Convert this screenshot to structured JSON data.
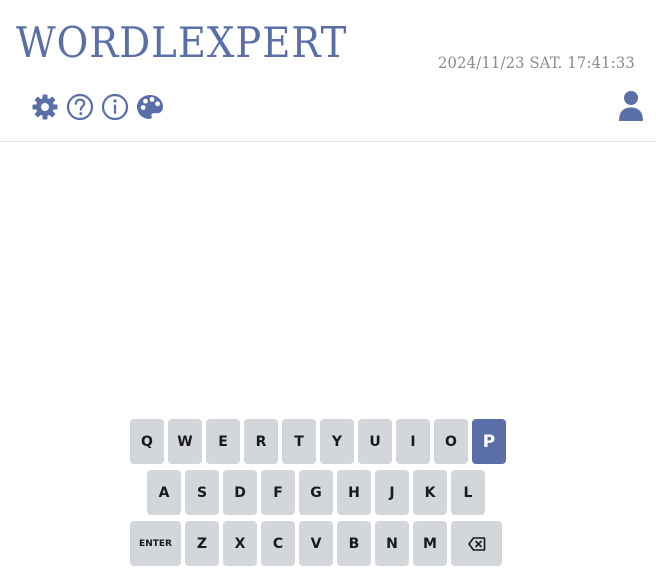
{
  "header": {
    "logo": "WORDLEXPERT",
    "datetime": "2024/11/23 SAT. 17:41:33"
  },
  "toolbar": {
    "icons": [
      "gear-icon",
      "help-icon",
      "info-icon",
      "palette-icon"
    ],
    "user_icon": "user-icon"
  },
  "keyboard": {
    "row1": [
      "Q",
      "W",
      "E",
      "R",
      "T",
      "Y",
      "U",
      "I",
      "O",
      "P"
    ],
    "row2": [
      "A",
      "S",
      "D",
      "F",
      "G",
      "H",
      "J",
      "K",
      "L"
    ],
    "row3": [
      "ENTER",
      "Z",
      "X",
      "C",
      "V",
      "B",
      "N",
      "M"
    ],
    "active_key": "P",
    "backspace_icon": "backspace-icon"
  },
  "colors": {
    "accent": "#5a6fa8",
    "key_bg": "#d3d6da",
    "datetime": "#8a8a8a"
  }
}
